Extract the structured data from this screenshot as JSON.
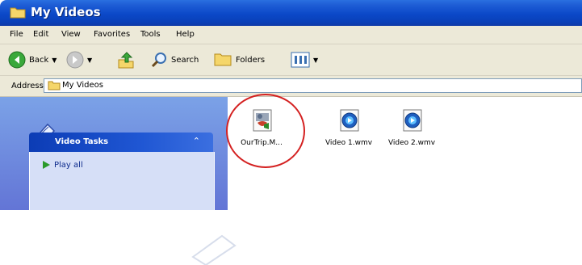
{
  "window": {
    "title": "My Videos"
  },
  "menu": [
    {
      "label": "File"
    },
    {
      "label": "Edit"
    },
    {
      "label": "View"
    },
    {
      "label": "Favorites"
    },
    {
      "label": "Tools"
    },
    {
      "label": "Help"
    }
  ],
  "toolbar": {
    "back_label": "Back",
    "search_label": "Search",
    "folders_label": "Folders"
  },
  "address": {
    "label": "Address",
    "value": "My Videos"
  },
  "tasks": {
    "header": "Video Tasks",
    "items": [
      {
        "label": "Play all"
      }
    ]
  },
  "files": [
    {
      "name": "OurTrip.M...",
      "icon": "movie-project-icon",
      "highlighted": true
    },
    {
      "name": "Video 1.wmv",
      "icon": "wmv-video-icon"
    },
    {
      "name": "Video 2.wmv",
      "icon": "wmv-video-icon"
    }
  ],
  "colors": {
    "accent": "#0b48c8",
    "highlight": "#d42020",
    "pane": "#6375d6"
  }
}
